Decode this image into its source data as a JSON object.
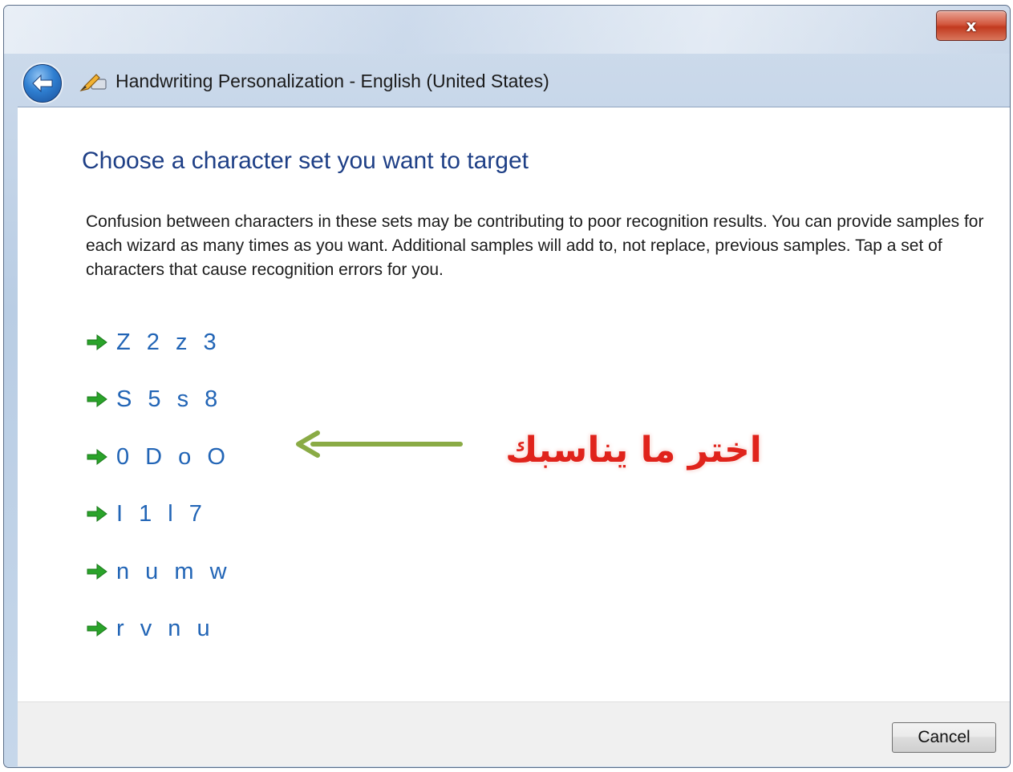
{
  "window": {
    "title": "Handwriting Personalization - English (United States)",
    "close_glyph": "x",
    "back_icon": "back-arrow-icon",
    "app_icon": "pen-tablet-icon"
  },
  "content": {
    "heading": "Choose a character set you want to target",
    "description": "Confusion between characters in these sets may be contributing to poor recognition results. You can provide samples for each wizard as many times as you want. Additional samples will add to, not replace, previous samples. Tap a set of characters that cause recognition errors for you.",
    "character_sets": [
      {
        "label": "Z 2 z 3"
      },
      {
        "label": "S 5 s 8"
      },
      {
        "label": "0 D o O"
      },
      {
        "label": "I 1 l 7"
      },
      {
        "label": "n u m w"
      },
      {
        "label": "r v n u"
      }
    ],
    "link_arrow_icon": "green-right-arrow-icon"
  },
  "annotation": {
    "text": "اختر ما يناسبك",
    "arrow_color": "#8aab45",
    "text_color": "#e0231b"
  },
  "footer": {
    "cancel_label": "Cancel"
  },
  "colors": {
    "heading": "#1e3f86",
    "link": "#2265b6",
    "link_arrow": "#2aa32a"
  }
}
